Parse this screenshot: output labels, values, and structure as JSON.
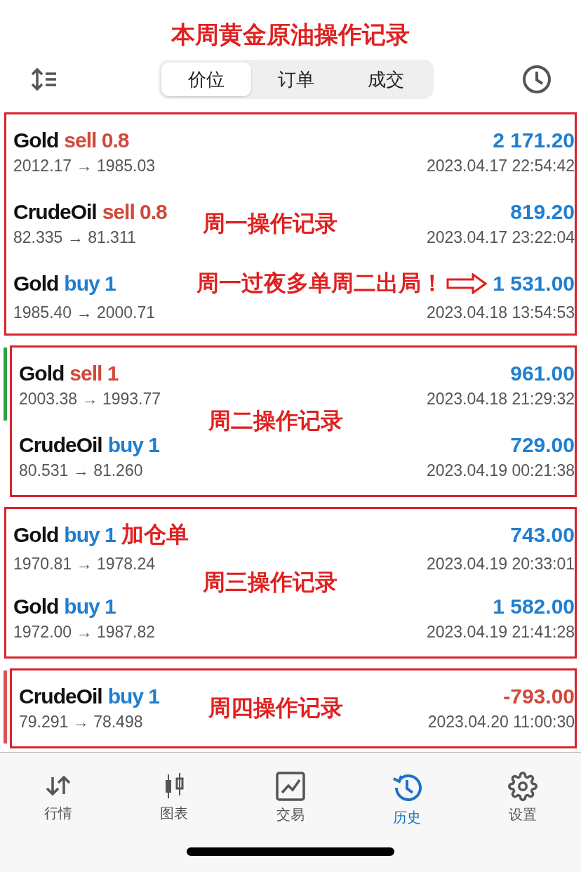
{
  "title": "本周黄金原油操作记录",
  "tabs": [
    {
      "label": "价位",
      "selected": true
    },
    {
      "label": "订单",
      "selected": false
    },
    {
      "label": "成交",
      "selected": false
    }
  ],
  "groups": [
    {
      "label": "周一操作记录",
      "deals": [
        {
          "symbol": "Gold",
          "order": "sell 0.8",
          "kind": "sell",
          "profit": {
            "text": "2 171.20",
            "kind": "gain"
          },
          "prices": "2012.17 → 1985.03",
          "time": "2023.04.17 22:54:42"
        },
        {
          "symbol": "CrudeOil",
          "order": "sell 0.8",
          "kind": "sell",
          "profit": {
            "text": "819.20",
            "kind": "gain"
          },
          "prices": "82.335 → 81.311",
          "time": "2023.04.17 23:22:04"
        },
        {
          "symbol": "Gold",
          "order": "buy 1",
          "kind": "buy",
          "note": "周一过夜多单周二出局！",
          "arrow": true,
          "profit": {
            "text": "1 531.00",
            "kind": "gain"
          },
          "prices": "1985.40 → 2000.71",
          "time": "2023.04.18 13:54:53"
        }
      ]
    },
    {
      "label": "周二操作记录",
      "color": "#2ea043",
      "deals": [
        {
          "symbol": "Gold",
          "order": "sell 1",
          "kind": "sell",
          "profit": {
            "text": "961.00",
            "kind": "gain"
          },
          "prices": "2003.38 → 1993.77",
          "time": "2023.04.18 21:29:32"
        },
        {
          "symbol": "CrudeOil",
          "order": "buy 1",
          "kind": "buy",
          "profit": {
            "text": "729.00",
            "kind": "gain"
          },
          "prices": "80.531 → 81.260",
          "time": "2023.04.19 00:21:38"
        }
      ]
    },
    {
      "label": "周三操作记录",
      "deals": [
        {
          "symbol": "Gold",
          "order": "buy 1",
          "kind": "buy",
          "note": "加仓单",
          "profit": {
            "text": "743.00",
            "kind": "gain"
          },
          "prices": "1970.81 → 1978.24",
          "time": "2023.04.19 20:33:01"
        },
        {
          "symbol": "Gold",
          "order": "buy 1",
          "kind": "buy",
          "profit": {
            "text": "1 582.00",
            "kind": "gain"
          },
          "prices": "1972.00 → 1987.82",
          "time": "2023.04.19 21:41:28"
        }
      ]
    },
    {
      "label": "周四操作记录",
      "color": "#d9534f",
      "deals": [
        {
          "symbol": "CrudeOil",
          "order": "buy 1",
          "kind": "buy",
          "profit": {
            "text": "-793.00",
            "kind": "loss"
          },
          "prices": "79.291 → 78.498",
          "time": "2023.04.20 11:00:30"
        }
      ]
    }
  ],
  "nav": [
    {
      "label": "行情",
      "selected": false
    },
    {
      "label": "图表",
      "selected": false
    },
    {
      "label": "交易",
      "selected": false
    },
    {
      "label": "历史",
      "selected": true
    },
    {
      "label": "设置",
      "selected": false
    }
  ]
}
